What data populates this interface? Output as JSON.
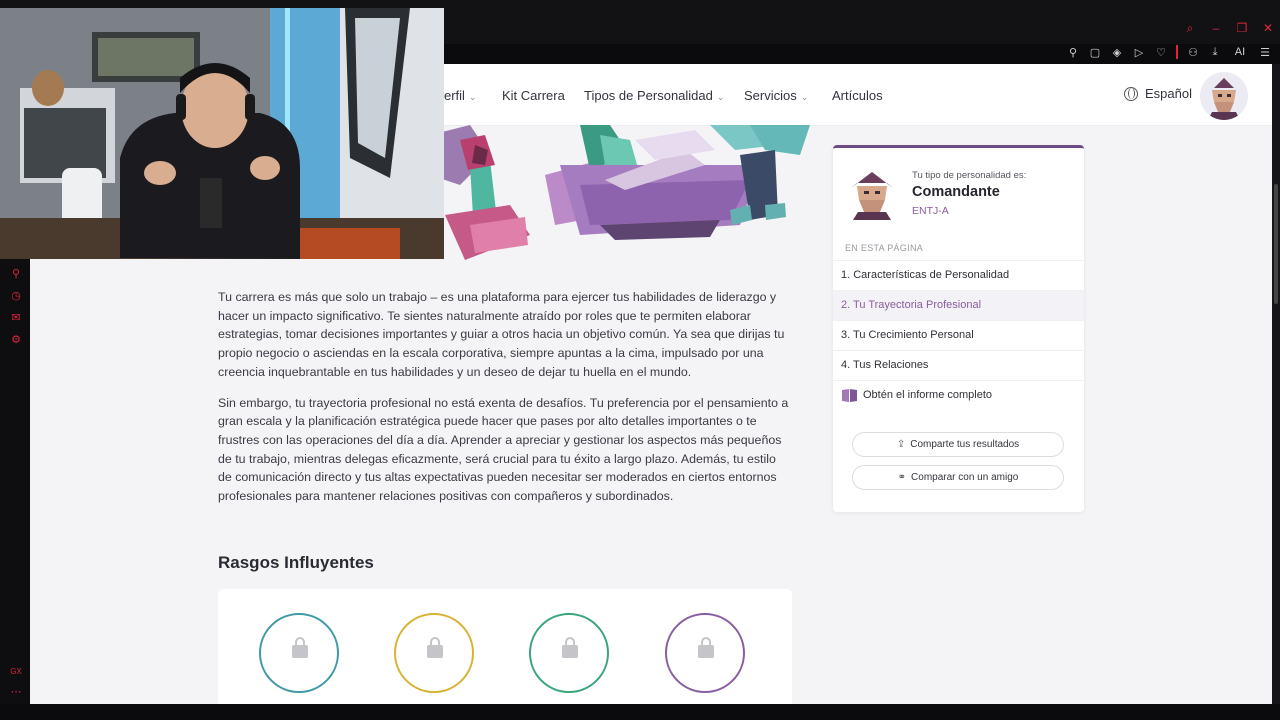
{
  "nav": {
    "items": [
      {
        "label": "erfil",
        "dropdown": true
      },
      {
        "label": "Kit Carrera",
        "dropdown": false
      },
      {
        "label": "Tipos de Personalidad",
        "dropdown": true
      },
      {
        "label": "Servicios",
        "dropdown": true
      },
      {
        "label": "Artículos",
        "dropdown": false
      }
    ],
    "language": "Español"
  },
  "article": {
    "paragraphs": [
      "Tu carrera es más que solo un trabajo – es una plataforma para ejercer tus habilidades de liderazgo y hacer un impacto significativo. Te sientes naturalmente atraído por roles que te permiten elaborar estrategias, tomar decisiones importantes y guiar a otros hacia un objetivo común. Ya sea que dirijas tu propio negocio o asciendas en la escala corporativa, siempre apuntas a la cima, impulsado por una creencia inquebrantable en tus habilidades y un deseo de dejar tu huella en el mundo.",
      "Sin embargo, tu trayectoria profesional no está exenta de desafíos. Tu preferencia por el pensamiento a gran escala y la planificación estratégica puede hacer que pases por alto detalles importantes o te frustres con las operaciones del día a día. Aprender a apreciar y gestionar los aspectos más pequeños de tu trabajo, mientras delegas eficazmente, será crucial para tu éxito a largo plazo. Además, tu estilo de comunicación directo y tus altas expectativas pueden necesitar ser moderados en ciertos entornos profesionales para mantener relaciones positivas con compañeros y subordinados."
    ],
    "section_title": "Rasgos Influyentes"
  },
  "traits": [
    {
      "color": "#3f9aa6",
      "icon": "lock-icon"
    },
    {
      "color": "#d7b334",
      "icon": "lock-icon"
    },
    {
      "color": "#3aa57a",
      "icon": "lock-icon"
    },
    {
      "color": "#875ea0",
      "icon": "lock-icon"
    }
  ],
  "sidebar": {
    "type_prompt": "Tu tipo de personalidad es:",
    "type_name": "Comandante",
    "type_code": "ENTJ-A",
    "section_label": "EN ESTA PÁGINA",
    "toc": [
      {
        "label": "1. Características de Personalidad",
        "active": false
      },
      {
        "label": "2. Tu Trayectoria Profesional",
        "active": true
      },
      {
        "label": "3. Tu Crecimiento Personal",
        "active": false
      },
      {
        "label": "4. Tus Relaciones",
        "active": false
      }
    ],
    "report_link": "Obtén el informe completo",
    "share_button": "Comparte tus resultados",
    "compare_button": "Comparar con un amigo"
  },
  "colors": {
    "accent": "#8a5c9c",
    "brand_bar": "#6e4a86",
    "browser_accent": "#e0243c"
  }
}
